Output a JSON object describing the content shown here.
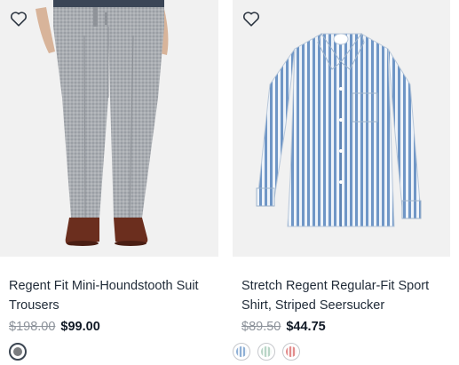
{
  "products": [
    {
      "title": "Regent Fit Mini-Houndstooth Suit Trousers",
      "price_original": "$198.00",
      "price_sale": "$99.00",
      "image_icon": "gray-trousers-image",
      "swatches": [
        {
          "name": "gray-swatch",
          "color": "#7b7d80",
          "selected": true
        }
      ]
    },
    {
      "title": "Stretch Regent Regular-Fit Sport Shirt, Striped Seersucker",
      "price_original": "$89.50",
      "price_sale": "$44.75",
      "image_icon": "striped-shirt-image",
      "swatches": [
        {
          "name": "blue-stripe-swatch",
          "color": "#8fb0d6",
          "selected": false
        },
        {
          "name": "green-stripe-swatch",
          "color": "#b9d5c7",
          "selected": false
        },
        {
          "name": "red-stripe-swatch",
          "color": "#e28c8c",
          "selected": false
        }
      ]
    }
  ]
}
